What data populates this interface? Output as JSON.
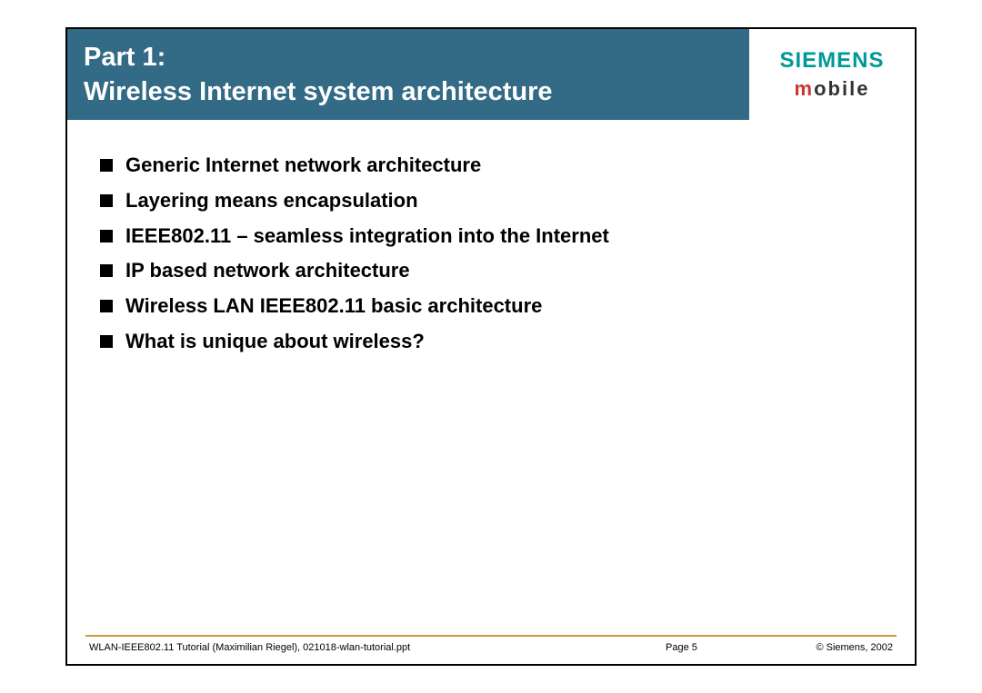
{
  "header": {
    "title_line1": "Part 1:",
    "title_line2": "Wireless Internet system architecture",
    "logo_main": "SIEMENS",
    "logo_sub_m": "m",
    "logo_sub_rest": "obile"
  },
  "bullets": [
    "Generic Internet network architecture",
    "Layering means encapsulation",
    "IEEE802.11 – seamless integration into the Internet",
    "IP based network architecture",
    "Wireless LAN IEEE802.11 basic architecture",
    "What is unique about wireless?"
  ],
  "footer": {
    "left": "WLAN-IEEE802.11 Tutorial (Maximilian Riegel), 021018-wlan-tutorial.ppt",
    "center": "Page  5",
    "right": "© Siemens, 2002"
  }
}
